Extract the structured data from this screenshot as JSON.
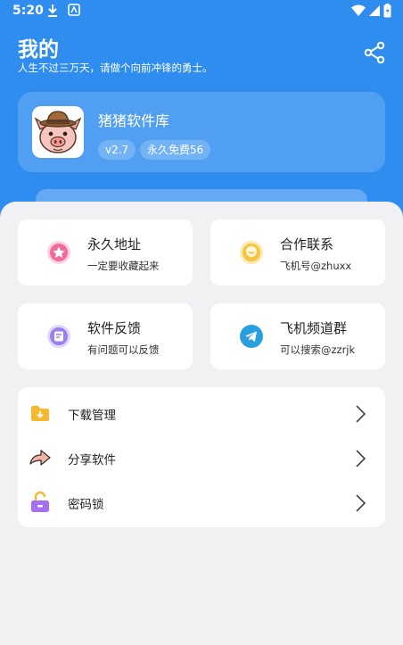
{
  "status_bar": {
    "time": "5:20"
  },
  "header": {
    "title": "我的",
    "subtitle": "人生不过三万天，请做个向前冲锋的勇士。"
  },
  "app": {
    "name": "猪猪软件库",
    "version_tag": "v2.7",
    "free_tag": "永久免费56"
  },
  "tiles": [
    {
      "title": "永久地址",
      "subtitle": "一定要收藏起来",
      "icon": "star-icon",
      "color": "#f2699a"
    },
    {
      "title": "合作联系",
      "subtitle": "飞机号@zhuxx",
      "icon": "chat-icon",
      "color": "#f5c542"
    },
    {
      "title": "软件反馈",
      "subtitle": "有问题可以反馈",
      "icon": "feedback-icon",
      "color": "#9a7ef2"
    },
    {
      "title": "飞机频道群",
      "subtitle": "可以搜索@zzrjk",
      "icon": "telegram-icon",
      "color": "#2a9fe0"
    }
  ],
  "menu": [
    {
      "label": "下载管理",
      "icon": "download-folder-icon",
      "color": "#f5b82e"
    },
    {
      "label": "分享软件",
      "icon": "share-arrow-icon",
      "color": "#e8806a"
    },
    {
      "label": "密码锁",
      "icon": "lock-icon",
      "color": "#a66ff0"
    }
  ],
  "colors": {
    "primary": "#2f8df0",
    "sheet": "#f1f1f3"
  }
}
